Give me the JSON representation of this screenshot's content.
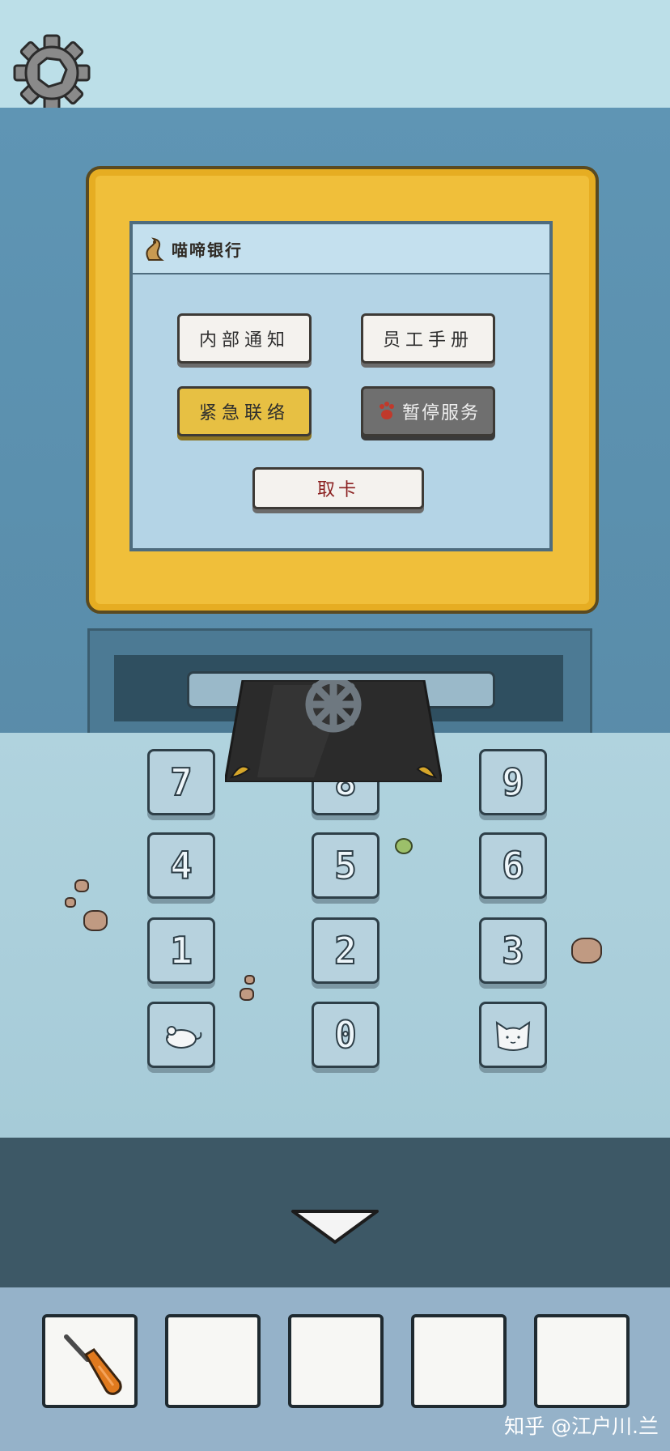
{
  "bank": {
    "name": "喵啼银行"
  },
  "screen_buttons": {
    "notice": "内部通知",
    "handbook": "员工手册",
    "emergency": "紧急联络",
    "pause": "暂停服务",
    "take_card": "取卡"
  },
  "keypad": {
    "keys": [
      "7",
      "8",
      "9",
      "4",
      "5",
      "6",
      "1",
      "2",
      "3",
      "0"
    ],
    "left_bottom_icon": "mouse-icon",
    "right_bottom_icon": "cat-face-icon"
  },
  "inventory": {
    "slots": [
      "screwdriver-icon",
      "",
      "",
      "",
      ""
    ]
  },
  "watermark": "知乎 @江户川.兰",
  "colors": {
    "frame_gold": "#f0bf3a",
    "screen_blue": "#b4d4e6",
    "emergency_yellow": "#e7c043",
    "pause_gray": "#6f6f6f",
    "wall_blue": "#5f95b4"
  }
}
